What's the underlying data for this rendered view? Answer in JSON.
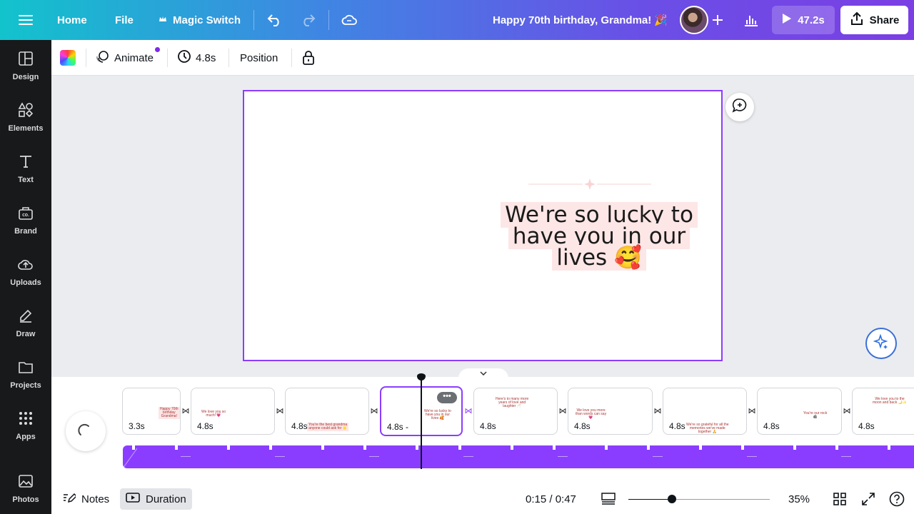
{
  "topbar": {
    "home_label": "Home",
    "file_label": "File",
    "magic_switch_label": "Magic Switch",
    "document_title": "Happy 70th birthday, Grandma! 🎉",
    "present_duration": "47.2s",
    "share_label": "Share"
  },
  "sidebar": {
    "items": [
      {
        "label": "Design",
        "icon": "design-icon"
      },
      {
        "label": "Elements",
        "icon": "elements-icon"
      },
      {
        "label": "Text",
        "icon": "text-icon"
      },
      {
        "label": "Brand",
        "icon": "brand-icon"
      },
      {
        "label": "Uploads",
        "icon": "uploads-icon"
      },
      {
        "label": "Draw",
        "icon": "draw-icon"
      },
      {
        "label": "Projects",
        "icon": "projects-icon"
      },
      {
        "label": "Apps",
        "icon": "apps-icon"
      },
      {
        "label": "Photos",
        "icon": "photos-icon"
      }
    ]
  },
  "toolbar": {
    "animate_label": "Animate",
    "duration_label": "4.8s",
    "position_label": "Position"
  },
  "canvas": {
    "headline": "We're so lucky to have you in our lives 🥰"
  },
  "timeline": {
    "clips": [
      {
        "duration": "3.3s",
        "thumb": "Happy 70th\nbirthday\nGrandma!"
      },
      {
        "duration": "4.8s",
        "thumb": "We love you so\nmuch! 💗"
      },
      {
        "duration": "4.8s",
        "thumb": "You're the best grandma\nanyone could ask for 🌟"
      },
      {
        "duration": "4.8s -",
        "thumb": "We're so lucky to\nhave you in our\nlives 🥰"
      },
      {
        "duration": "4.8s",
        "thumb": "Here's to many more\nyears of love and\nlaughter 🥂"
      },
      {
        "duration": "4.8s",
        "thumb": "We love you more\nthan words can say\n💗"
      },
      {
        "duration": "4.8s",
        "thumb": "We're so grateful for all the\nmemories we've made\ntogether 🙏"
      },
      {
        "duration": "4.8s",
        "thumb": "You're our rock\n🪨"
      },
      {
        "duration": "4.8s",
        "thumb": "We love you to the\nmoon and back 🌙✨"
      }
    ]
  },
  "bottombar": {
    "notes_label": "Notes",
    "duration_label": "Duration",
    "time_readout": "0:15 / 0:47",
    "zoom_level": "35%",
    "zoom_fraction": 0.31
  },
  "colors": {
    "accent": "#8b3dff",
    "sidebar_bg": "#18191b",
    "highlight_bg": "#fde6e6"
  }
}
